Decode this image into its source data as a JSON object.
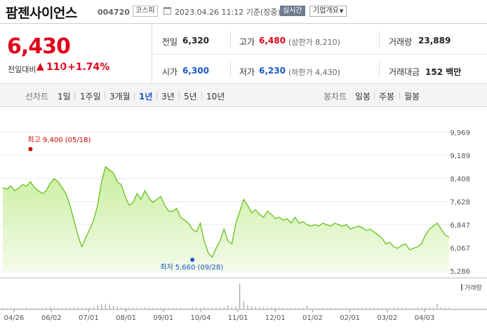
{
  "header": {
    "stock_name": "팜젠사이언스",
    "stock_code": "004720",
    "market": "코스피",
    "datetime": "2023.04.26 11:12",
    "basis": "기준(장중)",
    "realtime_label": "실시간",
    "company_label": "기업개요"
  },
  "quote": {
    "price": "6,430",
    "change_label": "전일대비",
    "change_value": "110",
    "change_pct": "+1.74%",
    "prev_close_label": "전일",
    "prev_close": "6,320",
    "high_label": "고가",
    "high": "6,480",
    "upper_limit": "(상한가 8,210)",
    "volume_label": "거래량",
    "volume": "23,889",
    "open_label": "시가",
    "open": "6,300",
    "low_label": "저가",
    "low": "6,230",
    "lower_limit": "(하한가 4,430)",
    "amount_label": "거래대금",
    "amount": "152 백만"
  },
  "tabs": {
    "line_label": "선차트",
    "periods": [
      "1일",
      "1주일",
      "3개월",
      "1년",
      "3년",
      "5년",
      "10년"
    ],
    "selected": "1년",
    "candle_label": "봉차트",
    "candles": [
      "일봉",
      "주봉",
      "월봉"
    ]
  },
  "chart_data": {
    "type": "area",
    "y_ticks": [
      "9,969",
      "9,189",
      "8,408",
      "7,628",
      "6,847",
      "6,067",
      "5,286"
    ],
    "ylim": [
      5286,
      9969
    ],
    "x_ticks": [
      "04/26",
      "06/02",
      "07/01",
      "08/01",
      "09/01",
      "10/04",
      "11/01",
      "12/01",
      "01/02",
      "02/01",
      "03/02",
      "04/03"
    ],
    "high_label": "최고 9,400 (05/18)",
    "low_label": "최저 5,660 (09/28)",
    "volume_label": "거래량",
    "series": [
      {
        "values": [
          8100,
          8050,
          8150,
          8000,
          8080,
          8200,
          8150,
          8300,
          8100,
          8000,
          7900,
          8000,
          8250,
          8400,
          8300,
          8100,
          7900,
          7500,
          7000,
          6500,
          6100,
          6400,
          6700,
          7000,
          7500,
          8300,
          8800,
          8700,
          8600,
          8300,
          8200,
          7800,
          7500,
          7600,
          7900,
          7700,
          8000,
          7750,
          7600,
          7700,
          7800,
          7500,
          7300,
          7300,
          7400,
          7100,
          7000,
          6900,
          6700,
          6600,
          6900,
          6300,
          5900,
          5750,
          6050,
          6300,
          6700,
          6300,
          6200,
          6900,
          7300,
          7700,
          7500,
          7250,
          7350,
          7200,
          7100,
          7300,
          7200,
          7050,
          7100,
          7000,
          7050,
          6900,
          7100,
          6900,
          6950,
          6850,
          6800,
          6850,
          6800,
          6900,
          6850,
          6800,
          6900,
          6850,
          6800,
          6850,
          6700,
          6750,
          6800,
          6750,
          6650,
          6700,
          6600,
          6500,
          6400,
          6200,
          6250,
          6100,
          6050,
          6150,
          6200,
          6000,
          6050,
          6100,
          6200,
          6500,
          6700,
          6800,
          6900,
          6700,
          6500,
          6430
        ]
      }
    ],
    "volume": [
      2,
      2,
      3,
      2,
      2,
      2,
      3,
      2,
      2,
      2,
      2,
      3,
      5,
      3,
      2,
      2,
      2,
      3,
      4,
      3,
      2,
      3,
      4,
      5,
      10,
      12,
      14,
      10,
      8,
      6,
      4,
      3,
      3,
      3,
      3,
      2,
      4,
      3,
      2,
      2,
      3,
      3,
      2,
      3,
      2,
      3,
      2,
      2,
      3,
      3,
      2,
      4,
      3,
      2,
      2,
      3,
      4,
      9,
      5,
      6,
      70,
      20,
      10,
      6,
      5,
      4,
      3,
      3,
      4,
      3,
      3,
      3,
      2,
      3,
      2,
      2,
      3,
      8,
      2,
      2,
      2,
      3,
      2,
      3,
      2,
      2,
      2,
      3,
      2,
      2,
      2,
      3,
      2,
      2,
      3,
      2,
      2,
      3,
      2,
      3,
      3,
      2,
      3,
      2,
      2,
      3,
      3,
      4,
      4,
      3,
      13,
      4,
      3,
      3
    ]
  }
}
